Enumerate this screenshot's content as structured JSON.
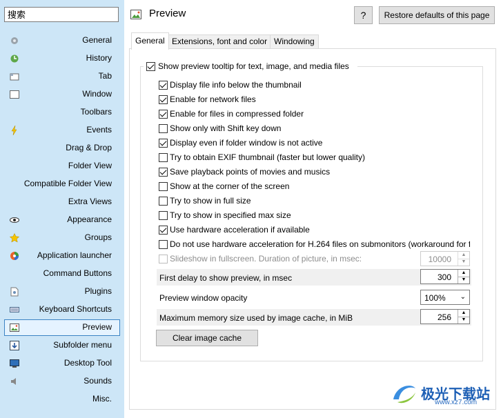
{
  "sidebar": {
    "search_placeholder": "搜索",
    "items": [
      {
        "label": "General",
        "icon": "gear-icon"
      },
      {
        "label": "History",
        "icon": "history-icon"
      },
      {
        "label": "Tab",
        "icon": "tab-icon"
      },
      {
        "label": "Window",
        "icon": "window-icon"
      },
      {
        "label": "Toolbars",
        "icon": ""
      },
      {
        "label": "Events",
        "icon": "lightning-icon"
      },
      {
        "label": "Drag & Drop",
        "icon": ""
      },
      {
        "label": "Folder View",
        "icon": ""
      },
      {
        "label": "Compatible Folder View",
        "icon": ""
      },
      {
        "label": "Extra Views",
        "icon": ""
      },
      {
        "label": "Appearance",
        "icon": "eye-icon"
      },
      {
        "label": "Groups",
        "icon": "star-icon"
      },
      {
        "label": "Application launcher",
        "icon": "launcher-icon"
      },
      {
        "label": "Command Buttons",
        "icon": ""
      },
      {
        "label": "Plugins",
        "icon": "plugin-icon"
      },
      {
        "label": "Keyboard Shortcuts",
        "icon": "keyboard-icon"
      },
      {
        "label": "Preview",
        "icon": "picture-icon",
        "selected": true
      },
      {
        "label": "Subfolder menu",
        "icon": "arrow-down-icon"
      },
      {
        "label": "Desktop Tool",
        "icon": "monitor-icon"
      },
      {
        "label": "Sounds",
        "icon": "speaker-icon"
      },
      {
        "label": "Misc.",
        "icon": ""
      }
    ]
  },
  "header": {
    "title": "Preview",
    "help_label": "?",
    "restore_label": "Restore defaults of this page"
  },
  "tabs": [
    {
      "label": "General",
      "active": true
    },
    {
      "label": "Extensions, font and color",
      "active": false
    },
    {
      "label": "Windowing",
      "active": false
    }
  ],
  "main": {
    "group_checkbox": {
      "label": "Show preview tooltip for text, image, and media files",
      "checked": true
    },
    "options": [
      {
        "label": "Display file info below the thumbnail",
        "checked": true
      },
      {
        "label": "Enable for network files",
        "checked": true
      },
      {
        "label": "Enable for files in compressed folder",
        "checked": true
      },
      {
        "label": "Show only with Shift key down",
        "checked": false
      },
      {
        "label": "Display even if folder window is not active",
        "checked": true
      },
      {
        "label": "Try to obtain EXIF thumbnail (faster but lower quality)",
        "checked": false
      },
      {
        "label": "Save playback points of movies and musics",
        "checked": true
      },
      {
        "label": "Show at the corner of the screen",
        "checked": false
      },
      {
        "label": "Try to show in full size",
        "checked": false
      },
      {
        "label": "Try to show in specified max size",
        "checked": false
      },
      {
        "label": "Use hardware acceleration if available",
        "checked": true
      },
      {
        "label": "Do not use hardware acceleration for H.264 files  on submonitors (workaround for f",
        "checked": false
      }
    ],
    "slideshow": {
      "label": "Slideshow in fullscreen. Duration of picture, in msec:",
      "checked": false,
      "disabled": true,
      "value": "10000"
    },
    "first_delay": {
      "label": "First delay to show preview, in msec",
      "value": "300"
    },
    "opacity": {
      "label": "Preview window opacity",
      "value": "100%"
    },
    "cache_size": {
      "label": "Maximum memory size used by image cache, in MiB",
      "value": "256"
    },
    "clear_cache_label": "Clear image cache"
  },
  "watermark": {
    "text": "极光下载站",
    "url": "www.xz7.com"
  },
  "colors": {
    "sidebar_bg": "#cde6f7",
    "selection_border": "#3b83c4",
    "accent": "#1d5fb5"
  }
}
